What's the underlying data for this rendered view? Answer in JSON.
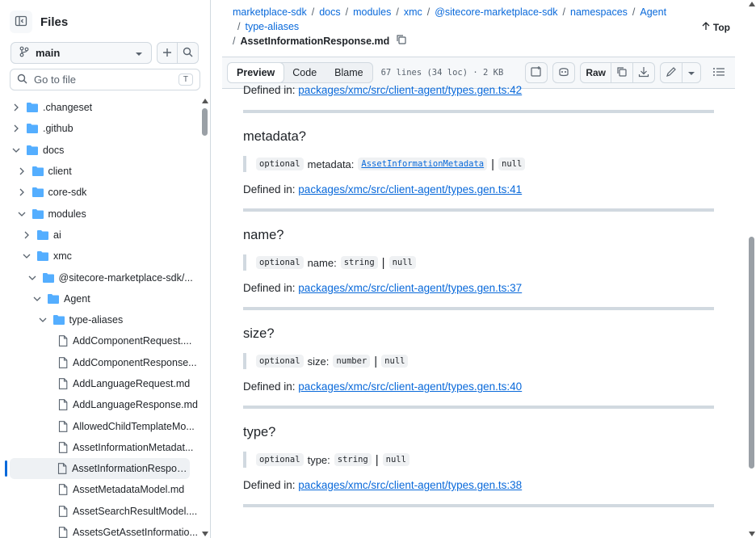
{
  "sidebar": {
    "title": "Files",
    "branch": "main",
    "goto_placeholder": "Go to file",
    "goto_shortcut": "T",
    "tree": [
      {
        "label": ".changeset",
        "type": "folder",
        "depth": 0,
        "open": false
      },
      {
        "label": ".github",
        "type": "folder",
        "depth": 0,
        "open": false
      },
      {
        "label": "docs",
        "type": "folder",
        "depth": 0,
        "open": true
      },
      {
        "label": "client",
        "type": "folder",
        "depth": 1,
        "open": false
      },
      {
        "label": "core-sdk",
        "type": "folder",
        "depth": 1,
        "open": false
      },
      {
        "label": "modules",
        "type": "folder",
        "depth": 1,
        "open": true
      },
      {
        "label": "ai",
        "type": "folder",
        "depth": 2,
        "open": false
      },
      {
        "label": "xmc",
        "type": "folder",
        "depth": 2,
        "open": true
      },
      {
        "label": "@sitecore-marketplace-sdk/...",
        "type": "folder",
        "depth": 3,
        "open": true
      },
      {
        "label": "Agent",
        "type": "folder",
        "depth": 4,
        "open": true
      },
      {
        "label": "type-aliases",
        "type": "folder",
        "depth": 5,
        "open": true
      },
      {
        "label": "AddComponentRequest....",
        "type": "file",
        "depth": 6
      },
      {
        "label": "AddComponentResponse...",
        "type": "file",
        "depth": 6
      },
      {
        "label": "AddLanguageRequest.md",
        "type": "file",
        "depth": 6
      },
      {
        "label": "AddLanguageResponse.md",
        "type": "file",
        "depth": 6
      },
      {
        "label": "AllowedChildTemplateMo...",
        "type": "file",
        "depth": 6
      },
      {
        "label": "AssetInformationMetadat...",
        "type": "file",
        "depth": 6
      },
      {
        "label": "AssetInformationRespons...",
        "type": "file",
        "depth": 6,
        "active": true
      },
      {
        "label": "AssetMetadataModel.md",
        "type": "file",
        "depth": 6
      },
      {
        "label": "AssetSearchResultModel....",
        "type": "file",
        "depth": 6
      },
      {
        "label": "AssetsGetAssetInformatio...",
        "type": "file",
        "depth": 6
      }
    ]
  },
  "breadcrumb": {
    "parts": [
      "marketplace-sdk",
      "docs",
      "modules",
      "xmc",
      "@sitecore-marketplace-sdk",
      "namespaces",
      "Agent",
      "type-aliases"
    ],
    "file": "AssetInformationResponse.md",
    "top_label": "Top"
  },
  "toolbar": {
    "tabs": [
      "Preview",
      "Code",
      "Blame"
    ],
    "meta": "67 lines (34 loc) · 2 KB",
    "raw": "Raw"
  },
  "doc": {
    "first_defined": "packages/xmc/src/client-agent/types.gen.ts:42",
    "defined_prefix": "Defined in: ",
    "optional": "optional",
    "null": "null",
    "props": [
      {
        "heading": "metadata?",
        "name": "metadata",
        "type": "AssetInformationMetadata",
        "type_link": true,
        "defined": "packages/xmc/src/client-agent/types.gen.ts:41"
      },
      {
        "heading": "name?",
        "name": "name",
        "type": "string",
        "type_link": false,
        "defined": "packages/xmc/src/client-agent/types.gen.ts:37"
      },
      {
        "heading": "size?",
        "name": "size",
        "type": "number",
        "type_link": false,
        "defined": "packages/xmc/src/client-agent/types.gen.ts:40"
      },
      {
        "heading": "type?",
        "name": "type",
        "type": "string",
        "type_link": false,
        "defined": "packages/xmc/src/client-agent/types.gen.ts:38"
      }
    ]
  },
  "colors": {
    "link": "#0969da",
    "border": "#d1d9e0",
    "accent": "#0969da",
    "folder": "#54aeff"
  }
}
